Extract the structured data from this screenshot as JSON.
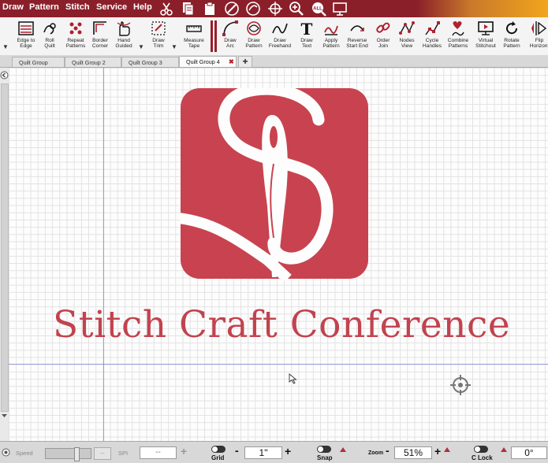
{
  "menu": {
    "items": [
      "Draw",
      "Pattern",
      "Stitch",
      "Service",
      "Help"
    ],
    "icons": [
      "scissors-icon",
      "copy-icon",
      "paste-icon",
      "draw-icon",
      "slash-circle-icon",
      "crosshair-icon",
      "zoom-in-icon",
      "zoom-out-icon",
      "screen-icon"
    ]
  },
  "toolbar": {
    "tools": [
      {
        "label": "Edge to\nEdge",
        "icon": "edge-to-edge-icon"
      },
      {
        "label": "Roll\nQuilt",
        "icon": "roll-quilt-icon"
      },
      {
        "label": "Repeat\nPatterns",
        "icon": "repeat-patterns-icon"
      },
      {
        "label": "Border\nCorner",
        "icon": "border-corner-icon"
      },
      {
        "label": "Hand\nGuided",
        "icon": "hand-guided-icon"
      },
      {
        "label": "Draw\nTrim",
        "icon": "draw-trim-icon"
      },
      {
        "label": "Measure\nTape",
        "icon": "measure-tape-icon"
      },
      {
        "label": "Draw\nArc",
        "icon": "draw-arc-icon"
      },
      {
        "label": "Draw\nPattern",
        "icon": "draw-pattern-icon"
      },
      {
        "label": "Draw\nFreehand",
        "icon": "draw-freehand-icon"
      },
      {
        "label": "Draw\nText",
        "icon": "draw-text-icon"
      },
      {
        "label": "Apply\nPattern",
        "icon": "apply-pattern-icon"
      },
      {
        "label": "Reverse\nStart End",
        "icon": "reverse-start-end-icon"
      },
      {
        "label": "Order\nJoin",
        "icon": "order-join-icon"
      },
      {
        "label": "Nodes\nView",
        "icon": "nodes-view-icon"
      },
      {
        "label": "Cycle\nHandles",
        "icon": "cycle-handles-icon"
      },
      {
        "label": "Combine\nPatterns",
        "icon": "combine-patterns-icon"
      },
      {
        "label": "Virtual\nStitchout",
        "icon": "virtual-stitchout-icon"
      },
      {
        "label": "Rotate\nPattern",
        "icon": "rotate-pattern-icon"
      },
      {
        "label": "Flip\nHorizont",
        "icon": "flip-horizontal-icon"
      }
    ]
  },
  "tabs": {
    "items": [
      "Quilt Group",
      "Quilt Group 2",
      "Quilt Group 3",
      "Quilt Group 4"
    ],
    "active": "Quilt Group 4",
    "close_glyph": "✖",
    "add_glyph": "+"
  },
  "canvas": {
    "title_text": "Stitch Craft Conference",
    "logo_color": "#c8434f",
    "text_color": "#c1434f",
    "guide_color": "#7a7ad2"
  },
  "status": {
    "speed_label": "Speed",
    "dash_btn": "--",
    "spi_label": "SPI",
    "spi_value": "--",
    "plus": "+",
    "minus": "-",
    "grid_label": "Grid",
    "grid_value": "1\"",
    "snap_label": "Snap",
    "zoom_label": "Zoom",
    "zoom_value": "51%",
    "clock_label": "C Lock",
    "angle_value": "0°"
  },
  "colors": {
    "menubar": "#8a1f2a",
    "accent": "#9a1e2a"
  }
}
